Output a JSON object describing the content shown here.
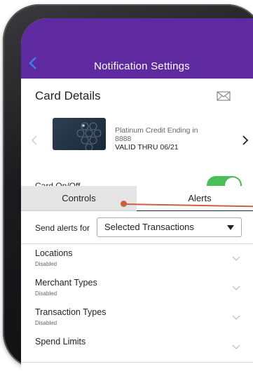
{
  "header": {
    "title": "Notification Settings",
    "back_icon": "chevron-left-icon"
  },
  "card_details": {
    "label": "Card Details",
    "icon": "mail-icon"
  },
  "card": {
    "line1": "Platinum Credit Ending in",
    "line2": "8888",
    "line3": "VALID THRU 06/21",
    "prev_icon": "chevron-left-icon",
    "next_icon": "chevron-right-icon"
  },
  "card_toggle": {
    "label": "Card On/Off",
    "on": true
  },
  "tabs": [
    {
      "label": "Controls",
      "active": false
    },
    {
      "label": "Alerts",
      "active": true
    }
  ],
  "send_alerts": {
    "label": "Send alerts for",
    "selected": "Selected Transactions"
  },
  "list": [
    {
      "title": "Locations",
      "status": "Disabled"
    },
    {
      "title": "Merchant Types",
      "status": "Disabled"
    },
    {
      "title": "Transaction Types",
      "status": "Disabled"
    },
    {
      "title": "Spend Limits",
      "status": ""
    }
  ],
  "colors": {
    "header": "#5f2a9f",
    "toggle_on": "#4bbf57",
    "annotation": "#c9603e",
    "back_icon": "#3b82f6"
  }
}
